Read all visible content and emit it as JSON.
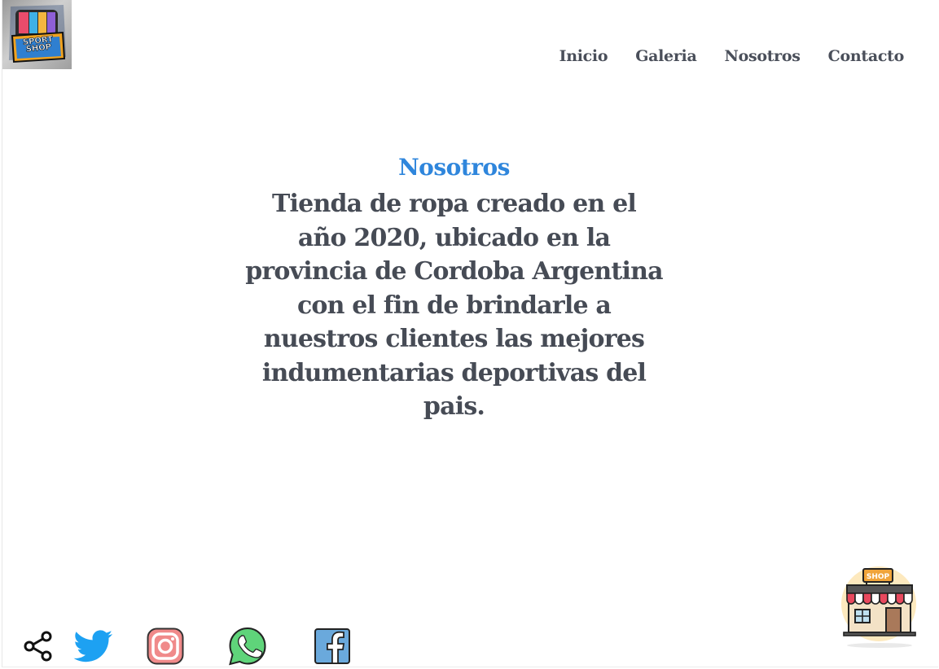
{
  "logo": {
    "line1": "SPORT",
    "line2": "SHOP"
  },
  "nav": {
    "items": [
      {
        "label": "Inicio"
      },
      {
        "label": "Galeria"
      },
      {
        "label": "Nosotros"
      },
      {
        "label": "Contacto"
      }
    ]
  },
  "about": {
    "title": "Nosotros",
    "body": "Tienda de ropa creado en el año 2020, ubicado en la provincia de Cordoba Argentina con el fin de brindarle a nuestros clientes las mejores indumentarias deportivas del pais."
  },
  "social": {
    "icons": [
      "share-icon",
      "twitter-icon",
      "instagram-icon",
      "whatsapp-icon",
      "facebook-icon"
    ]
  },
  "shop_badge": {
    "sign": "SHOP"
  },
  "colors": {
    "title_blue": "#2f86dc",
    "text_gray": "#464b55",
    "nav_gray": "#4a4f5a"
  }
}
